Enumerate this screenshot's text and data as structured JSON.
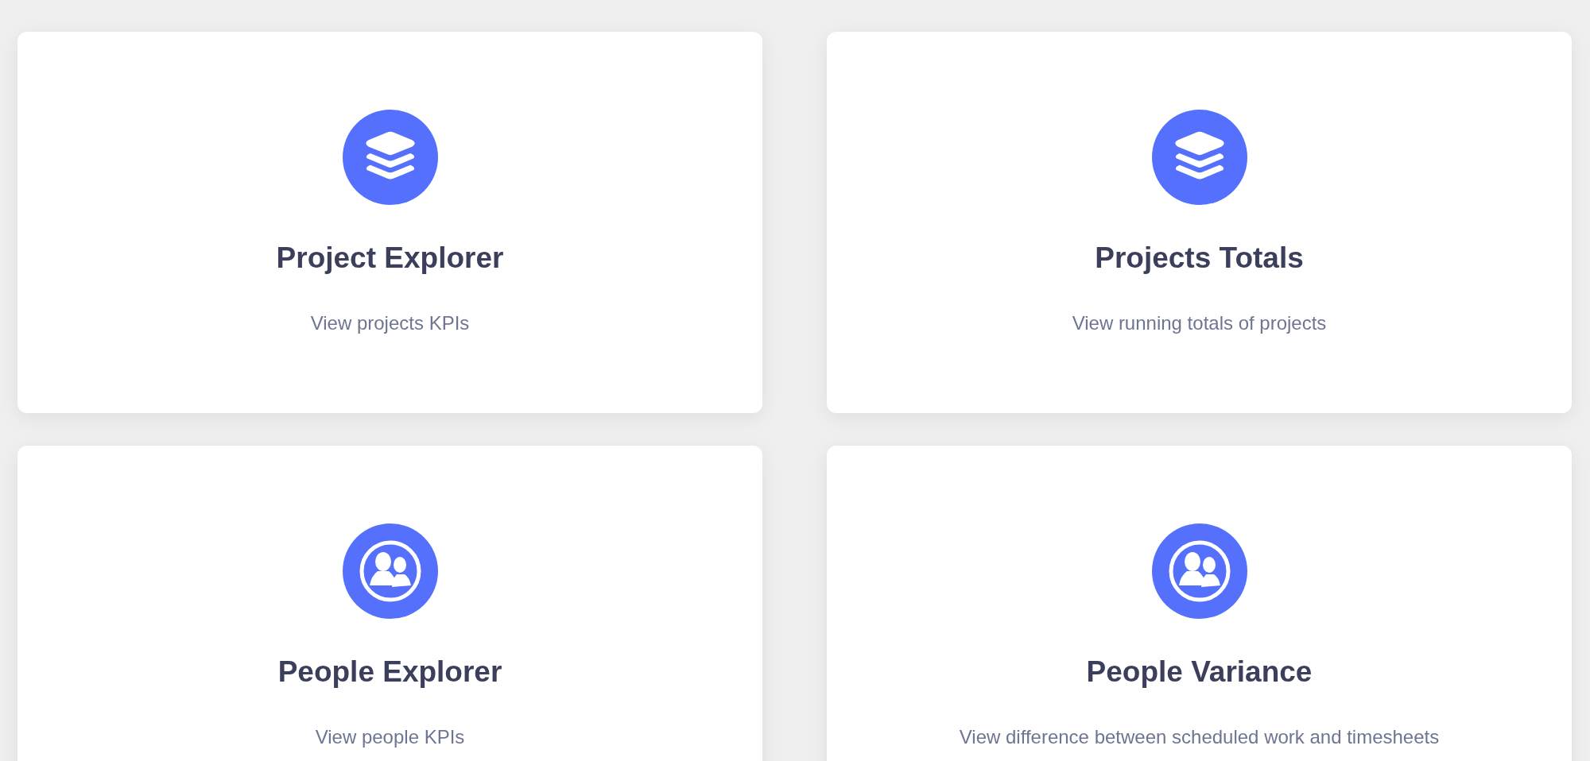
{
  "cards": [
    {
      "kind": "layers",
      "title": "Project Explorer",
      "description": "View projects KPIs"
    },
    {
      "kind": "layers",
      "title": "Projects Totals",
      "description": "View running totals of projects"
    },
    {
      "kind": "people",
      "title": "People Explorer",
      "description": "View people KPIs"
    },
    {
      "kind": "people",
      "title": "People Variance",
      "description": "View difference between scheduled work and timesheets"
    }
  ]
}
